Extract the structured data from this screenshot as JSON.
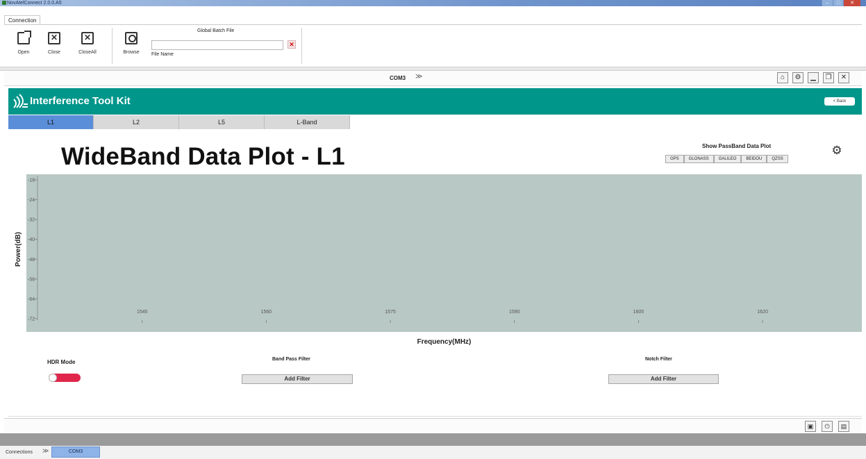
{
  "window": {
    "title": "NovAtelConnect 2.0.0.A5"
  },
  "ribbon": {
    "tab": "Connection",
    "buttons": {
      "open": "Open",
      "close": "Close",
      "close_all": "CloseAll",
      "browse": "Browse"
    },
    "batch": {
      "title": "Global Batch File",
      "file_label": "File Name",
      "value": ""
    }
  },
  "com_header": {
    "title": "COM3"
  },
  "banner": {
    "title": "Interference Tool Kit",
    "back": "< Back"
  },
  "tabs": [
    "L1",
    "L2",
    "L5",
    "L-Band"
  ],
  "plot": {
    "title": "WideBand Data Plot - L1"
  },
  "passband": {
    "title": "Show PassBand Data Plot",
    "buttons": [
      "GPS",
      "GLONASS",
      "GALILEO",
      "BEIDOU",
      "QZSS"
    ]
  },
  "chart_data": {
    "type": "line",
    "xlabel": "Frequency(MHz)",
    "ylabel": "Power(dB)",
    "x_ticks": [
      1545,
      1560,
      1575,
      1590,
      1605,
      1620
    ],
    "y_ticks": [
      -18,
      -24,
      -32,
      -40,
      -48,
      -56,
      -64,
      -72
    ],
    "xlim": [
      1531,
      1632
    ],
    "ylim": [
      -72,
      -18
    ],
    "series": [],
    "background": "#b8c8c4"
  },
  "controls": {
    "hdr_label": "HDR Mode",
    "hdr_on": false,
    "band_pass_label": "Band Pass Filter",
    "band_pass_button": "Add Filter",
    "notch_label": "Notch Filter",
    "notch_button": "Add Filter"
  },
  "footer": {
    "connections_label": "Connections",
    "active_tab": "COM3"
  },
  "colors": {
    "banner": "#00968a",
    "active_tab": "#5b8ed8",
    "toggle": "#e0264a"
  }
}
